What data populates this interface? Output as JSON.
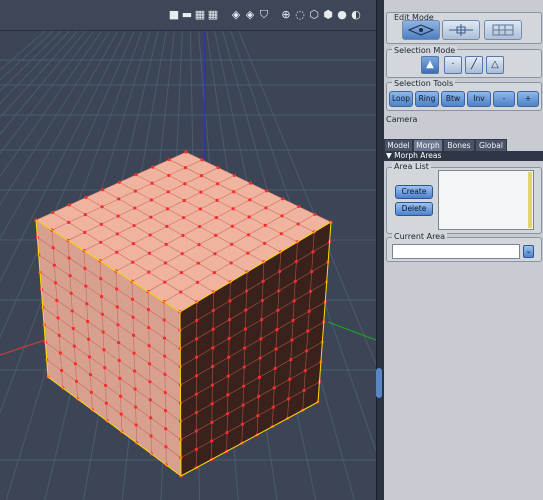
{
  "viewport": {
    "toolbar_icons": [
      "square-icon",
      "grid-2-icon",
      "grid-4-icon",
      "grid-4b-icon",
      "render-icon",
      "render-alt-icon",
      "render-shield-icon",
      "target-icon",
      "dotted-circle-icon",
      "cube-outline-icon",
      "cube-solid-icon",
      "sphere-icon",
      "half-sphere-icon"
    ],
    "colors": {
      "background": "#3b4556",
      "grid": "#4e5a6c",
      "cube_top": "#efb39f",
      "cube_left": "#d8a08f",
      "cube_right": "#3b211c",
      "vertex": "#ff2a2a",
      "edge": "#ffd700",
      "axis_blue": "#2b2bd8",
      "axis_green": "#1fa31f",
      "axis_red": "#c43b3b"
    }
  },
  "panel": {
    "edit_mode": {
      "title": "Edit Mode",
      "buttons": [
        "mesh-edit-icon",
        "transform-icon",
        "wireframe-icon"
      ],
      "active": 0
    },
    "selection_mode": {
      "title": "Selection Mode",
      "buttons": [
        "vertex-icon",
        "point-icon",
        "edge-icon",
        "face-icon"
      ],
      "active": 0
    },
    "selection_tools": {
      "title": "Selection Tools",
      "buttons": [
        "Loop",
        "Ring",
        "Btw",
        "Inv",
        "-",
        "+"
      ]
    },
    "camera_label": "Camera",
    "tabs": [
      {
        "label": "Model"
      },
      {
        "label": "Morph"
      },
      {
        "label": "Bones"
      },
      {
        "label": "Global"
      }
    ],
    "active_tab": "Morph",
    "section_header": "Morph Areas",
    "area_list": {
      "title": "Area List",
      "create_label": "Create",
      "delete_label": "Delete"
    },
    "current_area": {
      "title": "Current Area",
      "value": ""
    }
  }
}
